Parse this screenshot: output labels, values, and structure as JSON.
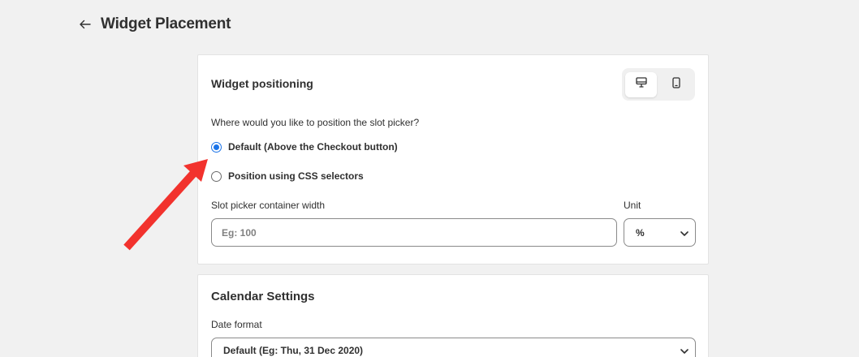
{
  "header": {
    "title": "Widget Placement",
    "back_icon": "arrow-left-icon"
  },
  "positioning": {
    "title": "Widget positioning",
    "device_toggle": [
      {
        "icon": "desktop-icon",
        "active": true
      },
      {
        "icon": "mobile-icon",
        "active": false
      }
    ],
    "question": "Where would you like to position the slot picker?",
    "options": [
      {
        "label": "Default (Above the Checkout button)",
        "checked": true
      },
      {
        "label": "Position using CSS selectors",
        "checked": false
      }
    ],
    "width_label": "Slot picker container width",
    "width_placeholder": "Eg: 100",
    "width_value": "",
    "unit_label": "Unit",
    "unit_value": "%"
  },
  "calendar": {
    "title": "Calendar Settings",
    "date_format_label": "Date format",
    "date_format_value": "Default (Eg: Thu, 31 Dec 2020)"
  },
  "colors": {
    "accent": "#1a73e8",
    "annotation_arrow": "#f2322d",
    "background": "#f1f1f1"
  }
}
